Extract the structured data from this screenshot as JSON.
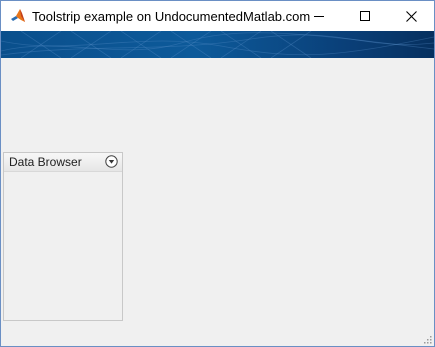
{
  "window": {
    "title": "Toolstrip example on UndocumentedMatlab.com",
    "app_icon": "matlab-logo-icon",
    "controls": {
      "minimize_icon": "minimize-icon",
      "maximize_icon": "maximize-icon",
      "close_icon": "close-icon"
    }
  },
  "panel": {
    "title": "Data Browser",
    "menu_icon": "chevron-down-circle-icon"
  },
  "colors": {
    "banner_start": "#0a4f8c",
    "banner_end": "#06305f",
    "background": "#f0f0f0",
    "window_border": "#6a8fc4"
  }
}
